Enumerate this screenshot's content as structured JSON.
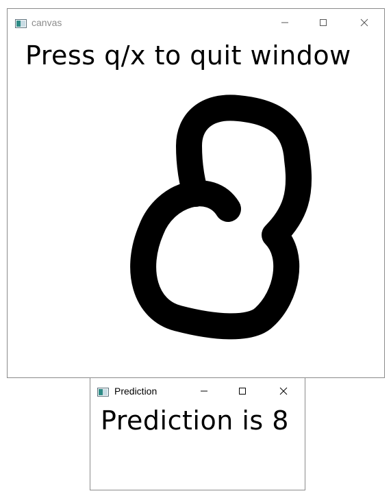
{
  "canvas_window": {
    "title": "canvas",
    "message": "Press q/x to quit window",
    "drawn_digit": "8"
  },
  "prediction_window": {
    "title": "Prediction",
    "message": "Prediction is 8"
  },
  "controls": {
    "minimize_icon": "minimize-icon",
    "maximize_icon": "maximize-icon",
    "close_icon": "close-icon"
  },
  "colors": {
    "background": "#ffffff",
    "ink": "#000000",
    "inactive_title": "#8c8c8c",
    "window_border": "#8a8a8a"
  }
}
